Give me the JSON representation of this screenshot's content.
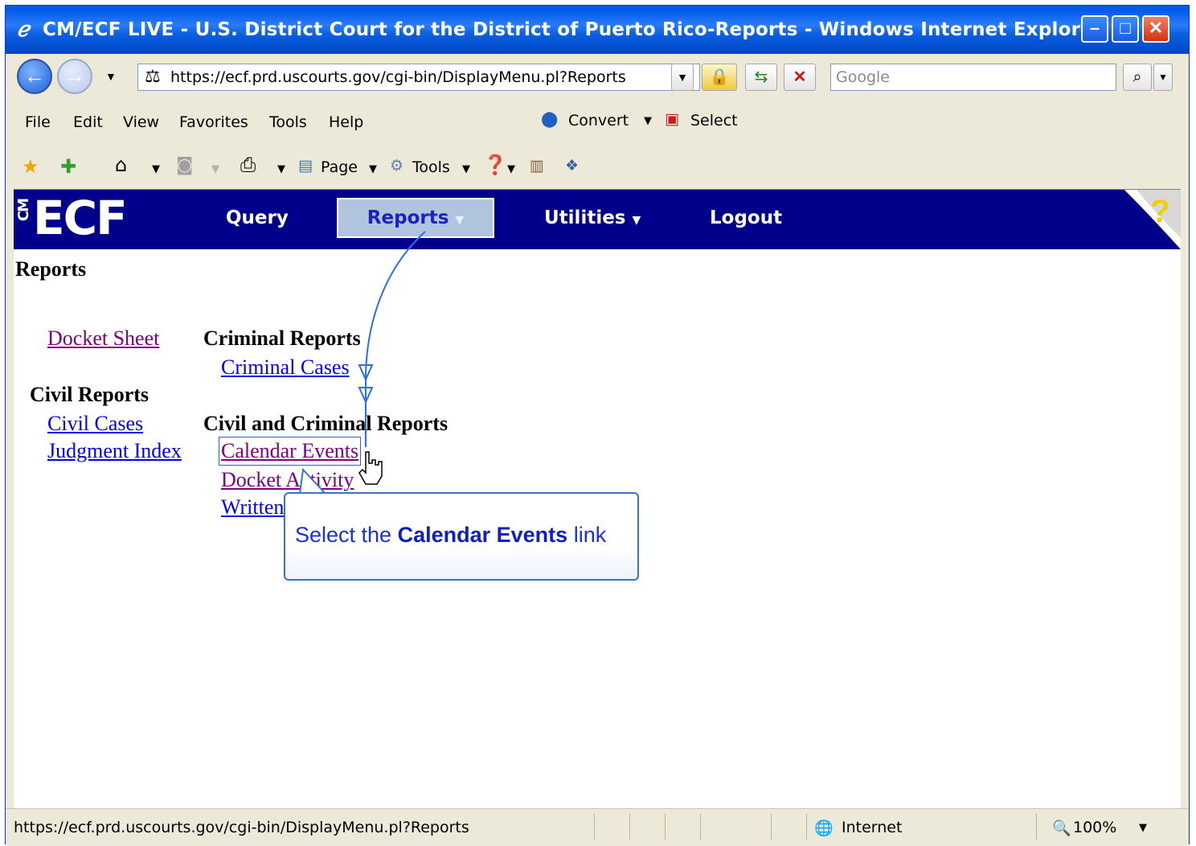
{
  "window": {
    "title": "CM/ECF LIVE - U.S. District Court for the District of Puerto Rico-Reports - Windows Internet Explorer",
    "buttons": [
      "minimize",
      "maximize",
      "close"
    ]
  },
  "address_bar": {
    "url": "https://ecf.prd.uscourts.gov/cgi-bin/DisplayMenu.pl?Reports",
    "search_placeholder": "Google"
  },
  "menu_bar": {
    "items": [
      "File",
      "Edit",
      "View",
      "Favorites",
      "Tools",
      "Help"
    ],
    "convert_label": "Convert",
    "select_label": "Select"
  },
  "command_bar": {
    "page_label": "Page",
    "tools_label": "Tools"
  },
  "ecf": {
    "logo_cm": "CM",
    "logo_ecf": "ECF",
    "nav": {
      "query": "Query",
      "reports": "Reports",
      "utilities": "Utilities",
      "logout": "Logout"
    },
    "help_glyph": "?"
  },
  "page": {
    "heading": "Reports",
    "docket_sheet": "Docket Sheet",
    "civil_reports": "Civil Reports",
    "civil_cases": "Civil Cases",
    "judgment_index": "Judgment Index",
    "criminal_reports": "Criminal Reports",
    "criminal_cases": "Criminal Cases",
    "civil_criminal_reports": "Civil and Criminal Reports",
    "calendar_events": "Calendar Events",
    "docket_activity": "Docket Activity",
    "written": "Written"
  },
  "callout": {
    "prefix": "Select the",
    "emphasis": "Calendar Events",
    "suffix": "link"
  },
  "status_bar": {
    "url": "https://ecf.prd.uscourts.gov/cgi-bin/DisplayMenu.pl?Reports",
    "zone": "Internet",
    "zoom": "100%"
  }
}
